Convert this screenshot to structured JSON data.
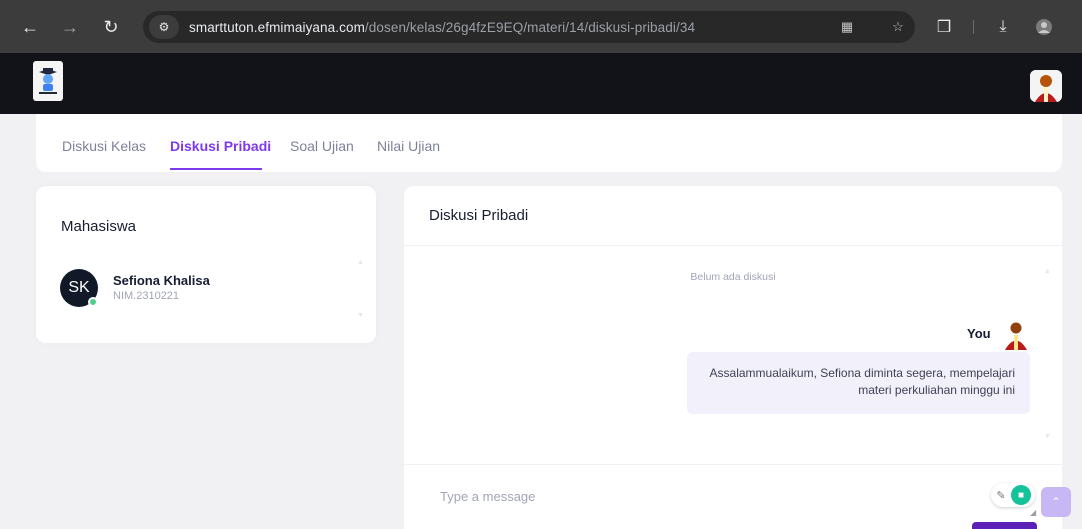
{
  "browser": {
    "url_host": "smarttuton.efmimaiyana.com",
    "url_path": "/dosen/kelas/26g4fzE9EQ/materi/14/diskusi-pribadi/34",
    "icons": [
      "back-icon",
      "forward-icon",
      "reload-icon",
      "site-info-icon",
      "translate-icon",
      "star-icon",
      "extensions-icon",
      "download-icon",
      "profile-icon"
    ]
  },
  "tabs": [
    {
      "label": "Diskusi Kelas",
      "active": false
    },
    {
      "label": "Diskusi Pribadi",
      "active": true
    },
    {
      "label": "Soal Ujian",
      "active": false
    },
    {
      "label": "Nilai Ujian",
      "active": false
    }
  ],
  "students_panel": {
    "title": "Mahasiswa",
    "students": [
      {
        "initials": "SK",
        "name": "Sefiona Khalisa",
        "nim": "NIM.2310221",
        "online": true
      }
    ]
  },
  "chat": {
    "title": "Diskusi Pribadi",
    "empty_note": "Belum ada diskusi",
    "messages": [
      {
        "sender": "You",
        "text": "Assalammualaikum, Sefiona diminta segera, mempelajari materi perkuliahan minggu ini"
      }
    ],
    "input_placeholder": "Type a message"
  },
  "colors": {
    "accent": "#7c3aed",
    "header_bg": "#111318",
    "bubble_bg": "#f1f0fb",
    "online": "#50cd89"
  }
}
